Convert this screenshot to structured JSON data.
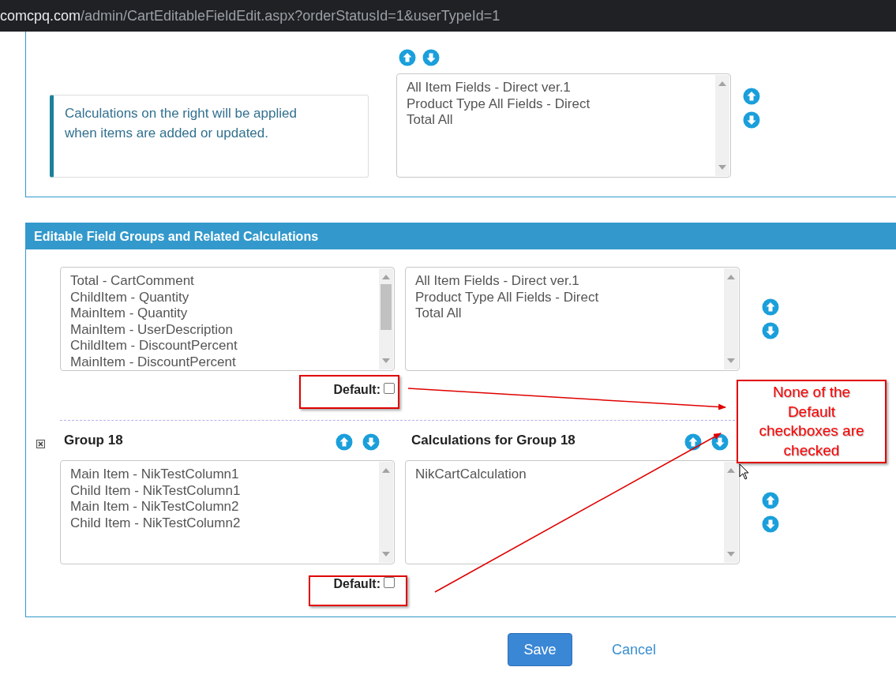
{
  "address_bar": {
    "host": "comcpq.com",
    "path": "/admin/CartEditableFieldEdit.aspx?orderStatusId=1&userTypeId=1"
  },
  "top_panel": {
    "info_text": "Calculations on the right will be applied when items are added or updated.",
    "calculations": [
      "All Item Fields - Direct ver.1",
      "Product Type All Fields - Direct",
      "Total All"
    ]
  },
  "groups_panel": {
    "title": "Editable Field Groups and Related Calculations",
    "groups": [
      {
        "fields": [
          "Total - CartComment",
          "ChildItem - Quantity",
          "MainItem - Quantity",
          "MainItem - UserDescription",
          "ChildItem - DiscountPercent",
          "MainItem - DiscountPercent"
        ],
        "calculations": [
          "All Item Fields - Direct ver.1",
          "Product Type All Fields - Direct",
          "Total All"
        ],
        "default_label": "Default:",
        "default_checked": false
      },
      {
        "title": "Group 18",
        "calculations_title": "Calculations for Group 18",
        "fields": [
          "Main Item - NikTestColumn1",
          "Child Item - NikTestColumn1",
          "Main Item - NikTestColumn2",
          "Child Item - NikTestColumn2"
        ],
        "calculations": [
          "NikCartCalculation"
        ],
        "default_label": "Default:",
        "default_checked": false
      }
    ]
  },
  "buttons": {
    "save": "Save",
    "cancel": "Cancel"
  },
  "annotation": {
    "callout": "None of the Default checkboxes are checked"
  }
}
